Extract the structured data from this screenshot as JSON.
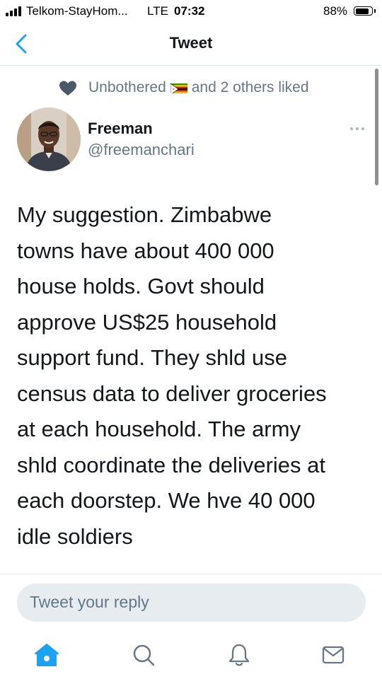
{
  "status_bar": {
    "carrier": "Telkom-StayHom...",
    "network": "LTE",
    "time": "07:32",
    "battery_percent": "88%",
    "battery_level": 0.88
  },
  "nav": {
    "back_icon": "chevron-left-icon",
    "title": "Tweet"
  },
  "social_context": {
    "icon": "heart-icon",
    "liker_name": "Unbothered",
    "liker_flag": "zimbabwe-flag-icon",
    "suffix": "and 2 others liked"
  },
  "tweet": {
    "author_name": "Freeman",
    "author_handle": "@freemanchari",
    "more_icon": "more-icon",
    "text_lines": [
      "My suggestion. Zimbabwe",
      "towns have about 400 000",
      "house holds. Govt should",
      "approve US$25 household",
      "support fund.  They shld use",
      "census data to deliver groceries",
      "at each household. The army",
      "shld coordinate the deliveries at",
      "each doorstep. We hve 40 000",
      "idle soldiers"
    ]
  },
  "reply": {
    "placeholder": "Tweet your reply"
  },
  "tab_bar": {
    "tabs": [
      "home-icon",
      "search-icon",
      "notifications-icon",
      "messages-icon"
    ],
    "active": "home-icon"
  },
  "colors": {
    "accent": "#1da1f2",
    "secondary_text": "#657786",
    "primary_text": "#14171a",
    "reply_bg": "#e6ecf0"
  }
}
